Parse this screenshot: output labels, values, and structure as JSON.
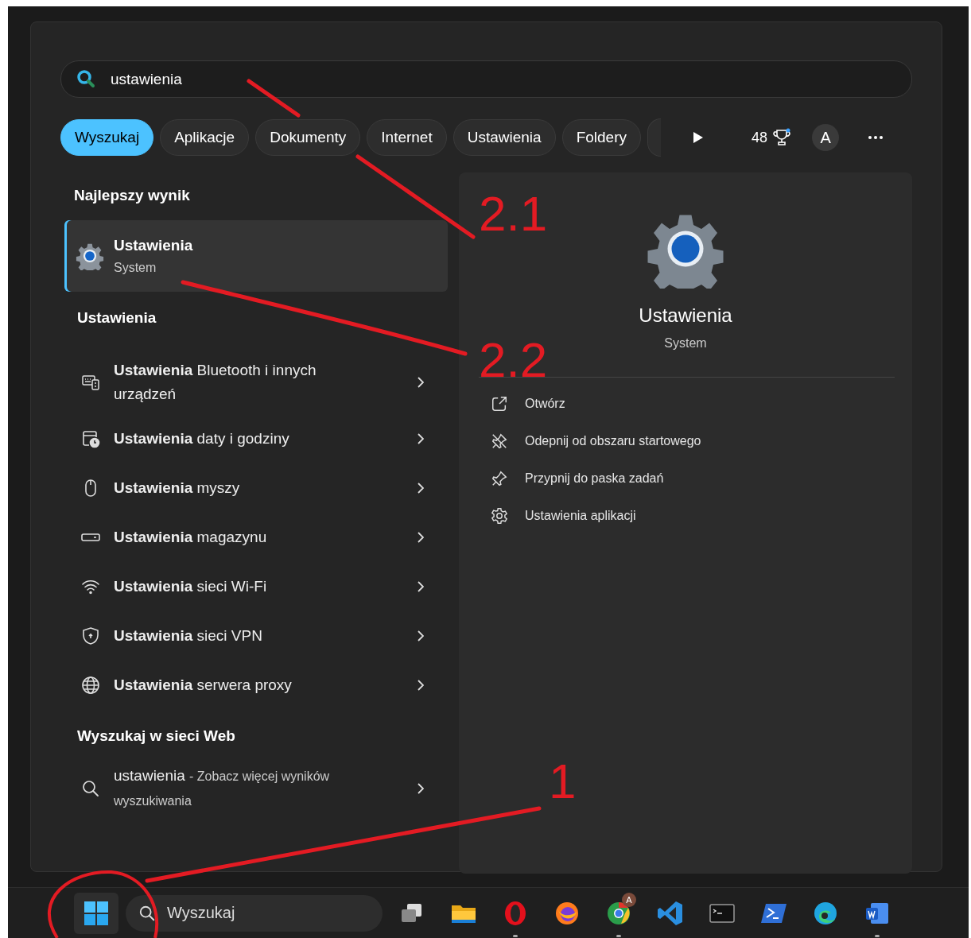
{
  "search": {
    "value": "ustawienia"
  },
  "filters": [
    {
      "label": "Wyszukaj",
      "selected": true
    },
    {
      "label": "Aplikacje",
      "selected": false
    },
    {
      "label": "Dokumenty",
      "selected": false
    },
    {
      "label": "Internet",
      "selected": false
    },
    {
      "label": "Ustawienia",
      "selected": false
    },
    {
      "label": "Foldery",
      "selected": false
    }
  ],
  "toolbar": {
    "points": "48",
    "avatar": "A"
  },
  "best_match": {
    "heading": "Najlepszy wynik",
    "title": "Ustawienia",
    "subtitle": "System",
    "selected": true
  },
  "settings_section": {
    "heading": "Ustawienia",
    "items": [
      {
        "text": "**Ustawienia** Bluetooth i innych urządzeń"
      },
      {
        "text": "**Ustawienia** daty i godziny"
      },
      {
        "text": "**Ustawienia** myszy"
      },
      {
        "text": "**Ustawienia** magazynu"
      },
      {
        "text": "**Ustawienia** sieci Wi-Fi"
      },
      {
        "text": "**Ustawienia** sieci VPN"
      },
      {
        "text": "**Ustawienia** serwera proxy"
      }
    ]
  },
  "web_section": {
    "heading": "Wyszukaj w sieci Web",
    "query": "ustawienia",
    "suffix": "- Zobacz więcej wyników wyszukiwania"
  },
  "details": {
    "title": "Ustawienia",
    "subtitle": "System",
    "actions": [
      "Otwórz",
      "Odepnij od obszaru startowego",
      "Przypnij do paska zadań",
      "Ustawienia aplikacji"
    ]
  },
  "taskbar": {
    "search_placeholder": "Wyszukaj",
    "apps": [
      {
        "running": false
      },
      {
        "running": false
      },
      {
        "running": true
      },
      {
        "running": false
      },
      {
        "running": true,
        "badge": "A"
      },
      {
        "running": false
      },
      {
        "running": false
      },
      {
        "running": false
      },
      {
        "running": false
      },
      {
        "running": true
      }
    ]
  },
  "annotations": [
    {
      "label": "2.1"
    },
    {
      "label": "2.2"
    },
    {
      "label": "1"
    }
  ]
}
